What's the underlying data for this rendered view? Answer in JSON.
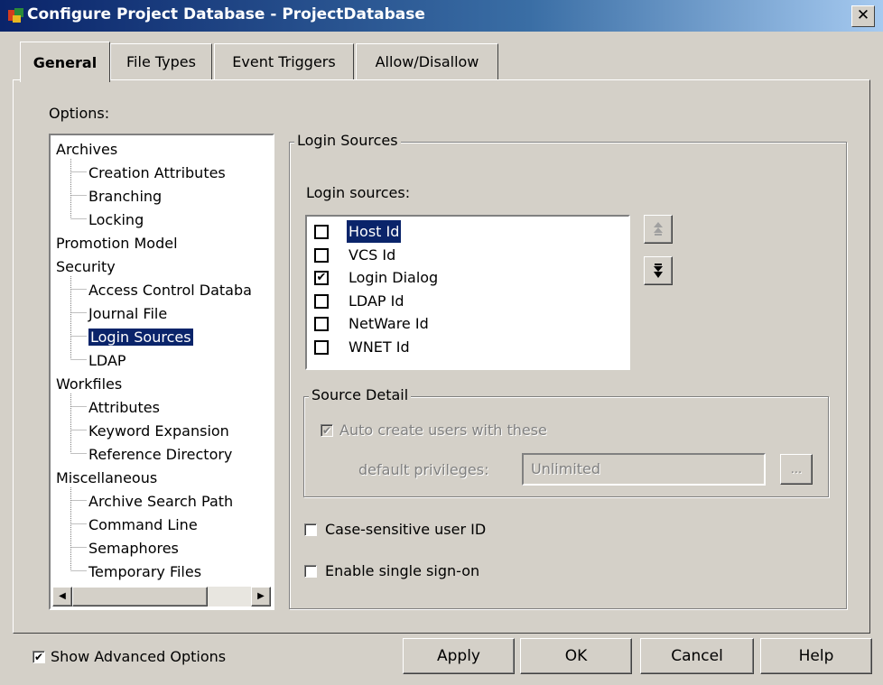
{
  "window": {
    "title": "Configure Project Database - ProjectDatabase",
    "close_glyph": "✕"
  },
  "tabs": [
    "General",
    "File Types",
    "Event Triggers",
    "Allow/Disallow"
  ],
  "options_label": "Options:",
  "tree": {
    "items": [
      {
        "label": "Archives",
        "level": 0
      },
      {
        "label": "Creation Attributes",
        "level": 1
      },
      {
        "label": "Branching",
        "level": 1
      },
      {
        "label": "Locking",
        "level": 1
      },
      {
        "label": "Promotion Model",
        "level": 0
      },
      {
        "label": "Security",
        "level": 0
      },
      {
        "label": "Access Control Databa",
        "level": 1
      },
      {
        "label": "Journal File",
        "level": 1
      },
      {
        "label": "Login Sources",
        "level": 1,
        "selected": true
      },
      {
        "label": "LDAP",
        "level": 1
      },
      {
        "label": "Workfiles",
        "level": 0
      },
      {
        "label": "Attributes",
        "level": 1
      },
      {
        "label": "Keyword Expansion",
        "level": 1
      },
      {
        "label": "Reference Directory",
        "level": 1
      },
      {
        "label": "Miscellaneous",
        "level": 0
      },
      {
        "label": "Archive Search Path",
        "level": 1
      },
      {
        "label": "Command Line",
        "level": 1
      },
      {
        "label": "Semaphores",
        "level": 1
      },
      {
        "label": "Temporary Files",
        "level": 1
      }
    ]
  },
  "login_sources_group": {
    "title": "Login Sources",
    "list_label": "Login sources:",
    "items": [
      {
        "label": "Host Id",
        "checked": false,
        "selected": true
      },
      {
        "label": "VCS Id",
        "checked": false
      },
      {
        "label": "Login Dialog",
        "checked": true
      },
      {
        "label": "LDAP Id",
        "checked": false
      },
      {
        "label": "NetWare Id",
        "checked": false
      },
      {
        "label": "WNET Id",
        "checked": false
      }
    ],
    "move_up_glyph": "⯭",
    "move_down_glyph": "⯯"
  },
  "source_detail": {
    "title": "Source Detail",
    "auto_create_label": "Auto create users with these",
    "auto_create_checked": true,
    "privileges_label": "default privileges:",
    "privileges_value": "Unlimited",
    "browse_label": "..."
  },
  "case_sensitive_label": "Case-sensitive user ID",
  "single_signon_label": "Enable single sign-on",
  "show_advanced_label": "Show Advanced Options",
  "show_advanced_checked": true,
  "buttons": {
    "apply": "Apply",
    "ok": "OK",
    "cancel": "Cancel",
    "help": "Help"
  },
  "check_glyph": "✔",
  "scroll_left_glyph": "◀",
  "scroll_right_glyph": "▶"
}
